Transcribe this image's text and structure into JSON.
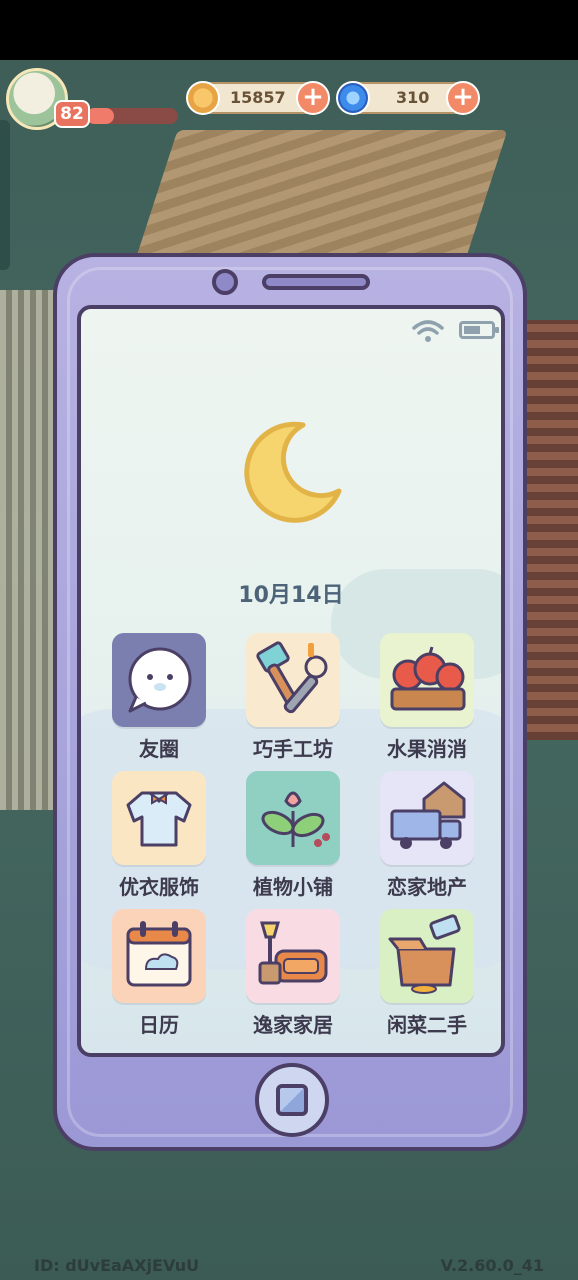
{
  "hud": {
    "level": "82",
    "xp_fraction": 0.3,
    "coins": "15857",
    "gems": "310",
    "plus_symbol": "+"
  },
  "phone": {
    "date": "10月14日",
    "status": {
      "wifi": "wifi-icon",
      "battery": "battery-icon"
    },
    "weather_icon": "moon-icon",
    "apps": [
      {
        "label": "友圈",
        "icon": "chat-bubble-icon",
        "color": "#7a7fb0"
      },
      {
        "label": "巧手工坊",
        "icon": "tools-icon",
        "color": "#f8e9cf"
      },
      {
        "label": "水果消消",
        "icon": "fruit-basket-icon",
        "color": "#eaf3cf"
      },
      {
        "label": "优衣服饰",
        "icon": "shirt-icon",
        "color": "#fbe6c4"
      },
      {
        "label": "植物小铺",
        "icon": "plant-icon",
        "color": "#8fd0c2"
      },
      {
        "label": "恋家地产",
        "icon": "moving-truck-icon",
        "color": "#e6e4f7"
      },
      {
        "label": "日历",
        "icon": "calendar-icon",
        "color": "#fbd3b8"
      },
      {
        "label": "逸家家居",
        "icon": "sofa-lamp-icon",
        "color": "#f9dce3"
      },
      {
        "label": "闲菜二手",
        "icon": "box-tag-icon",
        "color": "#d9efc4"
      }
    ]
  },
  "footer": {
    "id": "ID: dUvEaAXjEVuU",
    "version": "V.2.60.0_41"
  }
}
